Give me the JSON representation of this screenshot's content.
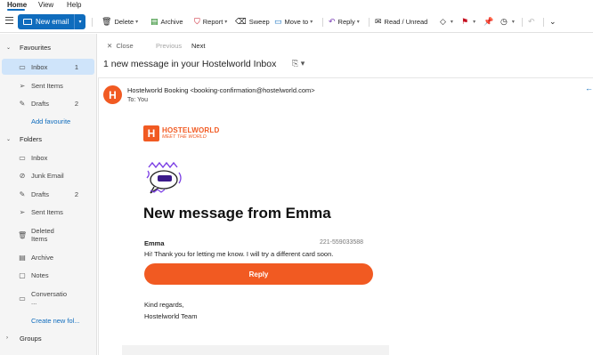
{
  "menubar": {
    "home": "Home",
    "view": "View",
    "help": "Help"
  },
  "ribbon": {
    "new_email": "New email",
    "delete": "Delete",
    "archive": "Archive",
    "report": "Report",
    "sweep": "Sweep",
    "move_to": "Move to",
    "reply": "Reply",
    "read_unread": "Read / Unread"
  },
  "sidebar": {
    "favourites": "Favourites",
    "fav_items": [
      {
        "label": "Inbox",
        "count": "1"
      },
      {
        "label": "Sent Items",
        "count": ""
      },
      {
        "label": "Drafts",
        "count": "2"
      }
    ],
    "add_favourite": "Add favourite",
    "folders": "Folders",
    "folder_items": [
      {
        "label": "Inbox",
        "count": ""
      },
      {
        "label": "Junk Email",
        "count": ""
      },
      {
        "label": "Drafts",
        "count": "2"
      },
      {
        "label": "Sent Items",
        "count": ""
      },
      {
        "label": "Deleted Items",
        "count": ""
      },
      {
        "label": "Archive",
        "count": ""
      },
      {
        "label": "Notes",
        "count": ""
      },
      {
        "label": "Conversatio ...",
        "count": ""
      }
    ],
    "create_new_folder": "Create new fol...",
    "groups": "Groups"
  },
  "reading": {
    "close": "Close",
    "previous": "Previous",
    "next": "Next",
    "subject": "1 new message in your Hostelworld Inbox",
    "from": "Hostelworld Booking <booking-confirmation@hostelworld.com>",
    "to": "To:  You",
    "avatar_letter": "H"
  },
  "email": {
    "brand": "HOSTELWORLD",
    "tagline": "MEET THE WORLD",
    "logo_letter": "H",
    "headline": "New message from Emma",
    "sender": "Emma",
    "message_id": "221-559033588",
    "message": "Hi! Thank you for letting me know. I will try a different card soon.",
    "reply_button": "Reply",
    "regards": "Kind regards,",
    "team": "Hostelworld Team"
  },
  "colors": {
    "accent": "#0f6cbd",
    "brand": "#f15a22",
    "selected": "#cfe4fa"
  }
}
